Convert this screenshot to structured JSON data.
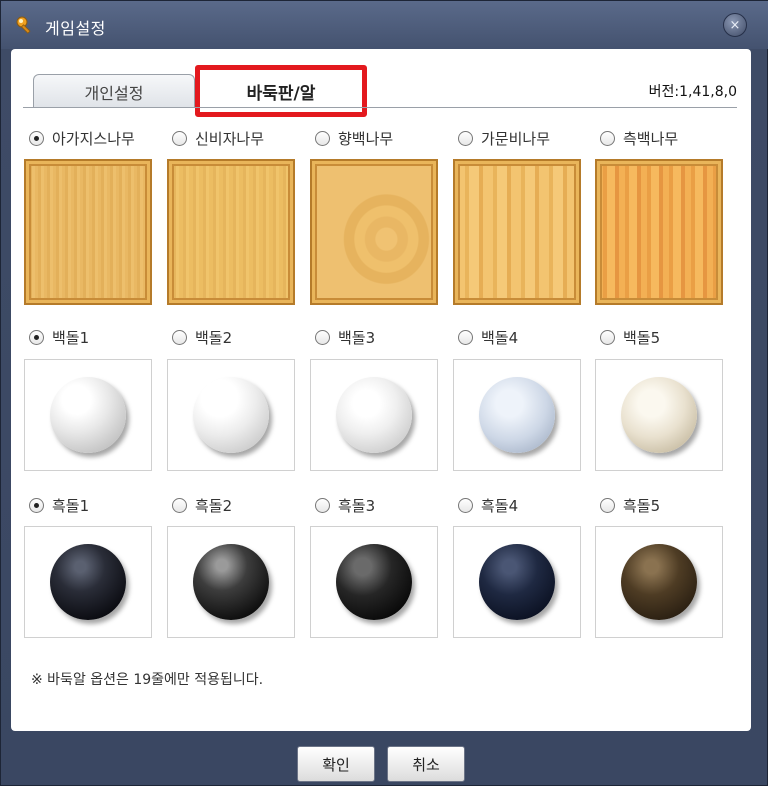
{
  "window": {
    "title": "게임설정",
    "close_label": "×"
  },
  "tabs": {
    "personal_label": "개인설정",
    "board_label": "바둑판/알",
    "active": "바둑판/알"
  },
  "version_label": "버전:1,41,8,0",
  "boards": [
    {
      "label": "아가지스나무",
      "checked": true
    },
    {
      "label": "신비자나무",
      "checked": false
    },
    {
      "label": "향백나무",
      "checked": false
    },
    {
      "label": "가문비나무",
      "checked": false
    },
    {
      "label": "측백나무",
      "checked": false
    }
  ],
  "white_stones": [
    {
      "label": "백돌1",
      "checked": true
    },
    {
      "label": "백돌2",
      "checked": false
    },
    {
      "label": "백돌3",
      "checked": false
    },
    {
      "label": "백돌4",
      "checked": false
    },
    {
      "label": "백돌5",
      "checked": false
    }
  ],
  "black_stones": [
    {
      "label": "흑돌1",
      "checked": true
    },
    {
      "label": "흑돌2",
      "checked": false
    },
    {
      "label": "흑돌3",
      "checked": false
    },
    {
      "label": "흑돌4",
      "checked": false
    },
    {
      "label": "흑돌5",
      "checked": false
    }
  ],
  "note": "※ 바둑알 옵션은 19줄에만 적용됩니다.",
  "buttons": {
    "ok_label": "확인",
    "cancel_label": "취소"
  },
  "colors": {
    "highlight": "#e3191e"
  }
}
